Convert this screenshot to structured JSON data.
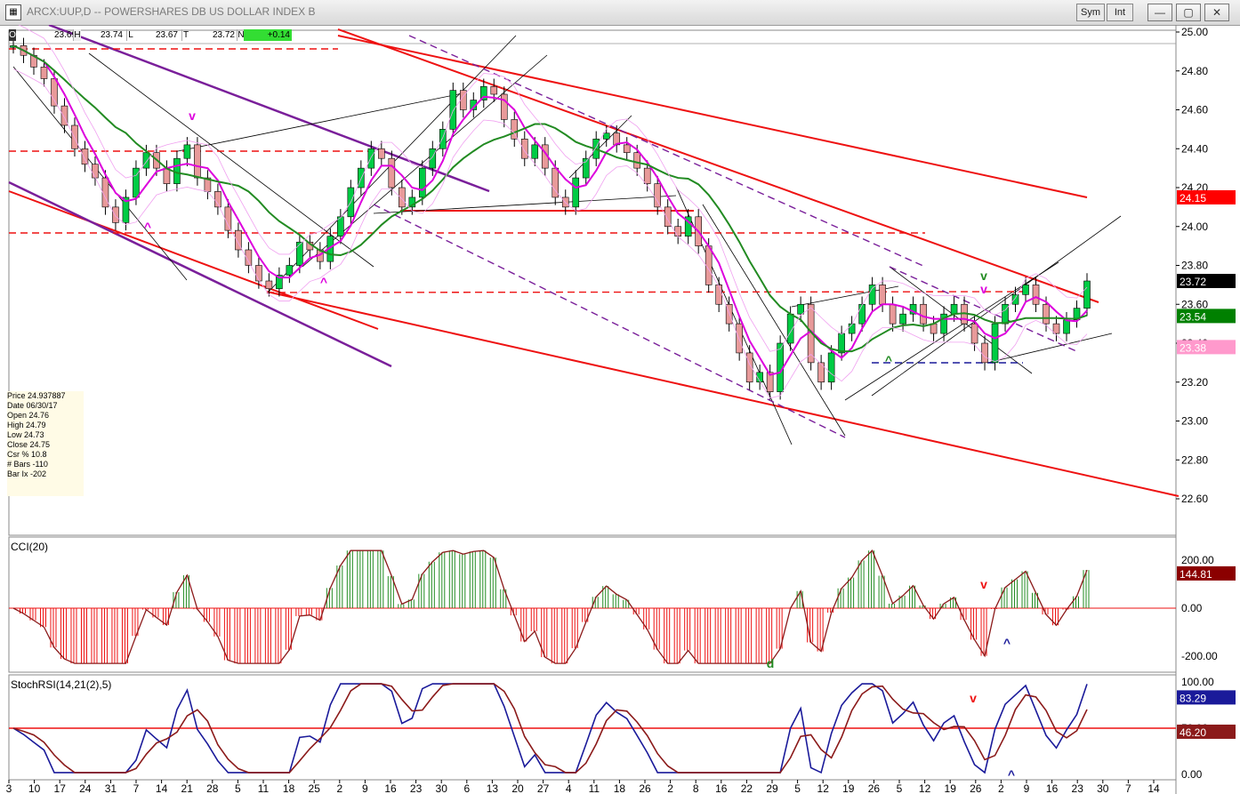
{
  "window": {
    "title": "ARCX:UUP,D -- POWERSHARES DB US DOLLAR INDEX B",
    "sym_button": "Sym",
    "int_button": "Int"
  },
  "ohlc_bar": {
    "o_label": "O",
    "o_value": "23.69",
    "h_label": "H",
    "h_value": "23.74",
    "l_label": "L",
    "l_value": "23.67",
    "t_label": "T",
    "t_value": "23.72",
    "n_label": "N",
    "n_value": "+0.14"
  },
  "info_box": {
    "price": "Price  24.937887",
    "date": "Date   06/30/17",
    "open": "Open  24.76",
    "high": "High   24.79",
    "low": "Low    24.73",
    "close": "Close  24.75",
    "csr": "Csr %  10.8",
    "bars": "# Bars -110",
    "barix": "Bar Ix  -202"
  },
  "price_axis": {
    "ticks": [
      "25.00",
      "24.80",
      "24.60",
      "24.40",
      "24.20",
      "24.00",
      "23.80",
      "23.60",
      "23.40",
      "23.20",
      "23.00",
      "22.80",
      "22.60"
    ],
    "tags": [
      {
        "text": "24.15",
        "value": 24.15,
        "bg": "#ff0000",
        "fg": "#ffffff"
      },
      {
        "text": "23.72",
        "value": 23.72,
        "bg": "#000000",
        "fg": "#ffffff"
      },
      {
        "text": "23.54",
        "value": 23.54,
        "bg": "#008000",
        "fg": "#ffffff"
      },
      {
        "text": "23.38",
        "value": 23.38,
        "bg": "#ff99cc",
        "fg": "#ffffff"
      }
    ]
  },
  "cci_panel": {
    "title": "CCI(20)",
    "ticks": [
      "200.00",
      "0.00",
      "-200.00"
    ],
    "tag": "144.81",
    "tag_color": "#8b0000"
  },
  "stoch_panel": {
    "title": "StochRSI(14,21(2),5)",
    "ticks": [
      "100.00",
      "50.00",
      "0.00"
    ],
    "tag_blue": "83.29",
    "tag_red": "46.20"
  },
  "x_axis": {
    "labels": [
      "3",
      "10",
      "17",
      "24",
      "31",
      "7",
      "14",
      "21",
      "28",
      "5",
      "11",
      "18",
      "25",
      "2",
      "9",
      "16",
      "23",
      "30",
      "6",
      "13",
      "20",
      "27",
      "4",
      "11",
      "18",
      "26",
      "2",
      "8",
      "16",
      "22",
      "29",
      "5",
      "12",
      "19",
      "26",
      "5",
      "12",
      "19",
      "26",
      "2",
      "9",
      "16",
      "23",
      "30",
      "7",
      "14"
    ]
  },
  "annotations": {
    "caret_up": "^",
    "caret_down": "v",
    "d_mark": "d"
  },
  "colors": {
    "up_candle": "#00cc44",
    "down_candle": "#e89a9a",
    "ma_fast": "#dd00dd",
    "ma_slow": "#228b22",
    "trend_red": "#ee1111",
    "trend_purple": "#7a1f9a",
    "cci_pos": "#228b22",
    "cci_neg": "#ee1111",
    "stoch_k": "#1a1a9a",
    "stoch_d": "#8b1a1a"
  },
  "chart_data": {
    "type": "candlestick",
    "title": "ARCX:UUP,D -- POWERSHARES DB US DOLLAR INDEX B",
    "ylim": [
      22.5,
      25.05
    ],
    "close_path": [
      24.93,
      24.88,
      24.82,
      24.76,
      24.62,
      24.52,
      24.4,
      24.32,
      24.25,
      24.1,
      24.02,
      24.15,
      24.3,
      24.38,
      24.3,
      24.22,
      24.35,
      24.42,
      24.25,
      24.18,
      24.1,
      23.98,
      23.88,
      23.8,
      23.72,
      23.68,
      23.75,
      23.8,
      23.92,
      23.88,
      23.82,
      23.95,
      24.05,
      24.2,
      24.3,
      24.4,
      24.35,
      24.2,
      24.1,
      24.15,
      24.3,
      24.4,
      24.5,
      24.7,
      24.6,
      24.65,
      24.72,
      24.68,
      24.55,
      24.45,
      24.35,
      24.42,
      24.3,
      24.15,
      24.1,
      24.25,
      24.35,
      24.45,
      24.48,
      24.42,
      24.38,
      24.3,
      24.22,
      24.1,
      24.0,
      23.95,
      24.05,
      23.9,
      23.7,
      23.6,
      23.5,
      23.35,
      23.2,
      23.25,
      23.15,
      23.4,
      23.55,
      23.6,
      23.3,
      23.2,
      23.35,
      23.45,
      23.5,
      23.6,
      23.7,
      23.6,
      23.5,
      23.55,
      23.6,
      23.5,
      23.45,
      23.55,
      23.6,
      23.5,
      23.4,
      23.3,
      23.5,
      23.6,
      23.65,
      23.7,
      23.6,
      23.5,
      23.45,
      23.52,
      23.58,
      23.72
    ]
  }
}
